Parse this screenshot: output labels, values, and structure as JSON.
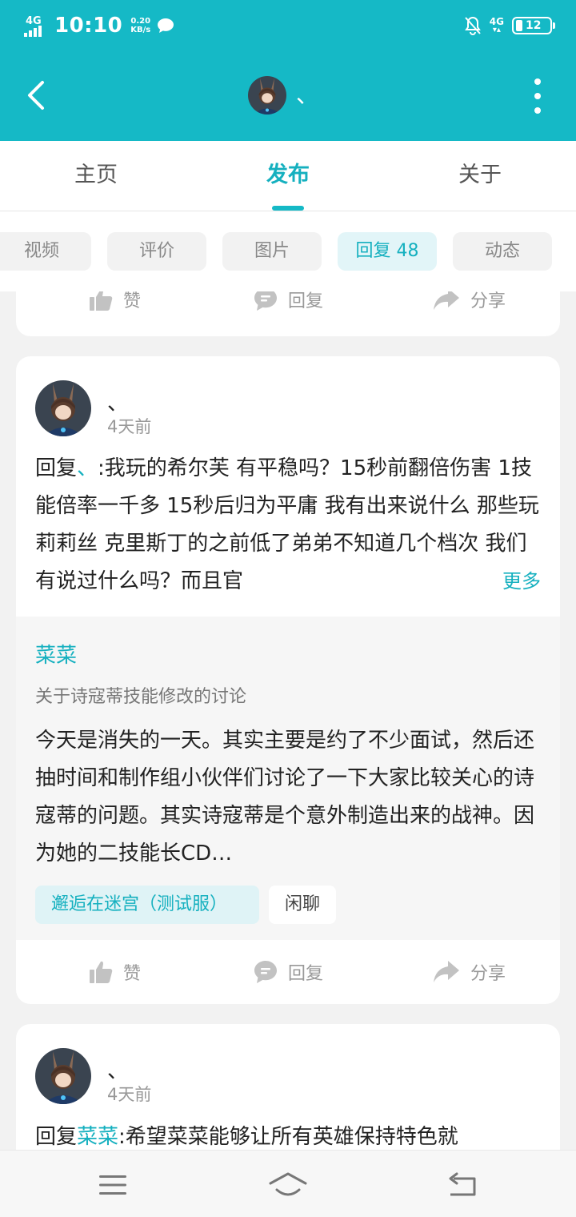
{
  "status_bar": {
    "network_left": "4G",
    "time": "10:10",
    "net_speed_value": "0.20",
    "net_speed_unit": "KB/s",
    "network_right": "4G",
    "battery": "12"
  },
  "header": {
    "title": "、",
    "accent_color": "#15b9c6"
  },
  "main_tabs": [
    {
      "label": "主页",
      "active": false
    },
    {
      "label": "发布",
      "active": true
    },
    {
      "label": "关于",
      "active": false
    }
  ],
  "sub_tabs": [
    {
      "label": "视频"
    },
    {
      "label": "评价"
    },
    {
      "label": "图片"
    },
    {
      "label": "回复 48",
      "active": true
    },
    {
      "label": "动态"
    }
  ],
  "actions": {
    "like": "赞",
    "reply": "回复",
    "share": "分享"
  },
  "posts": [
    {
      "author": "、",
      "time": "4天前",
      "reply_prefix": "回复",
      "reply_target": "、",
      "content": ":我玩的希尔芙 有平稳吗？15秒前翻倍伤害 1技能倍率一千多 15秒后归为平庸 我有出来说什么 那些玩莉莉丝 克里斯丁的之前低了弟弟不知道几个档次 我们有说过什么吗？而且官",
      "more": "更多",
      "quoted": {
        "author": "菜菜",
        "title": "关于诗寇蒂技能修改的讨论",
        "text": "今天是消失的一天。其实主要是约了不少面试，然后还抽时间和制作组小伙伴们讨论了一下大家比较关心的诗寇蒂的问题。其实诗寇蒂是个意外制造出来的战神。因为她的二技能长CD…",
        "tags": [
          "邂逅在迷宫（测试服）",
          "闲聊"
        ]
      }
    },
    {
      "author": "、",
      "time": "4天前",
      "reply_prefix": "回复",
      "reply_target": "菜菜",
      "content": ":希望菜菜能够让所有英雄保持特色就"
    }
  ]
}
